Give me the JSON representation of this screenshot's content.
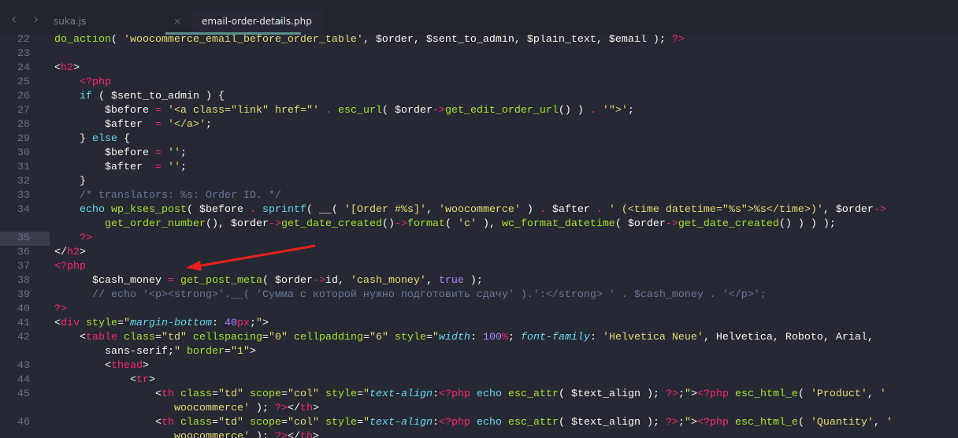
{
  "tabs": [
    {
      "label": "suka.js",
      "active": false
    },
    {
      "label": "email-order-details.php",
      "active": true
    }
  ],
  "close_glyph": "×",
  "nav": {
    "back": "‹",
    "forward": "›"
  },
  "current_line": "35",
  "rows": [
    {
      "num": "22",
      "tokens": [
        [
          "f",
          "do_action"
        ],
        [
          "v",
          "( "
        ],
        [
          "s",
          "'woocommerce_email_before_order_table'"
        ],
        [
          "v",
          ", $order, $sent_to_admin, $plain_text, $email ); "
        ],
        [
          "t",
          "?>"
        ]
      ]
    },
    {
      "num": "23",
      "tokens": []
    },
    {
      "num": "24",
      "tokens": [
        [
          "v",
          "<"
        ],
        [
          "t",
          "h2"
        ],
        [
          "v",
          ">"
        ]
      ]
    },
    {
      "num": "25",
      "tokens": [
        [
          "v",
          "    "
        ],
        [
          "t",
          "<?php"
        ]
      ]
    },
    {
      "num": "26",
      "tokens": [
        [
          "v",
          "    "
        ],
        [
          "k",
          "if"
        ],
        [
          "v",
          " ( $sent_to_admin ) {"
        ]
      ]
    },
    {
      "num": "27",
      "tokens": [
        [
          "v",
          "        $before "
        ],
        [
          "t",
          "="
        ],
        [
          "v",
          " "
        ],
        [
          "s",
          "'<a class=\"link\" href=\"'"
        ],
        [
          "v",
          " "
        ],
        [
          "t",
          "."
        ],
        [
          "v",
          " "
        ],
        [
          "f",
          "esc_url"
        ],
        [
          "v",
          "( $order"
        ],
        [
          "t",
          "->"
        ],
        [
          "f",
          "get_edit_order_url"
        ],
        [
          "v",
          "() ) "
        ],
        [
          "t",
          "."
        ],
        [
          "v",
          " "
        ],
        [
          "s",
          "'\">'"
        ],
        [
          "v",
          ";"
        ]
      ]
    },
    {
      "num": "28",
      "tokens": [
        [
          "v",
          "        $after  "
        ],
        [
          "t",
          "="
        ],
        [
          "v",
          " "
        ],
        [
          "s",
          "'</a>'"
        ],
        [
          "v",
          ";"
        ]
      ]
    },
    {
      "num": "29",
      "tokens": [
        [
          "v",
          "    } "
        ],
        [
          "k",
          "else"
        ],
        [
          "v",
          " {"
        ]
      ]
    },
    {
      "num": "30",
      "tokens": [
        [
          "v",
          "        $before "
        ],
        [
          "t",
          "="
        ],
        [
          "v",
          " "
        ],
        [
          "s",
          "''"
        ],
        [
          "v",
          ";"
        ]
      ]
    },
    {
      "num": "31",
      "tokens": [
        [
          "v",
          "        $after  "
        ],
        [
          "t",
          "="
        ],
        [
          "v",
          " "
        ],
        [
          "s",
          "''"
        ],
        [
          "v",
          ";"
        ]
      ]
    },
    {
      "num": "32",
      "tokens": [
        [
          "v",
          "    }"
        ]
      ]
    },
    {
      "num": "33",
      "tokens": [
        [
          "c",
          "    /* translators: %s: Order ID. */"
        ]
      ]
    },
    {
      "num": "34",
      "tokens": [
        [
          "v",
          "    "
        ],
        [
          "k",
          "echo"
        ],
        [
          "v",
          " "
        ],
        [
          "f",
          "wp_kses_post"
        ],
        [
          "v",
          "( $before "
        ],
        [
          "t",
          "."
        ],
        [
          "v",
          " "
        ],
        [
          "k",
          "sprintf"
        ],
        [
          "v",
          "( __( "
        ],
        [
          "s",
          "'[Order #%s]'"
        ],
        [
          "v",
          ", "
        ],
        [
          "s",
          "'woocommerce'"
        ],
        [
          "v",
          " ) "
        ],
        [
          "t",
          "."
        ],
        [
          "v",
          " $after "
        ],
        [
          "t",
          "."
        ],
        [
          "v",
          " "
        ],
        [
          "s",
          "' (<time datetime=\"%s\">%s</time>)'"
        ],
        [
          "v",
          ", $order"
        ],
        [
          "t",
          "->"
        ]
      ]
    },
    {
      "num": "",
      "tokens": [
        [
          "v",
          "        "
        ],
        [
          "f",
          "get_order_number"
        ],
        [
          "v",
          "(), $order"
        ],
        [
          "t",
          "->"
        ],
        [
          "f",
          "get_date_created"
        ],
        [
          "v",
          "()"
        ],
        [
          "t",
          "->"
        ],
        [
          "f",
          "format"
        ],
        [
          "v",
          "( "
        ],
        [
          "s",
          "'c'"
        ],
        [
          "v",
          " ), "
        ],
        [
          "f",
          "wc_format_datetime"
        ],
        [
          "v",
          "( $order"
        ],
        [
          "t",
          "->"
        ],
        [
          "f",
          "get_date_created"
        ],
        [
          "v",
          "() ) ) );"
        ]
      ]
    },
    {
      "num": "35",
      "tokens": [
        [
          "v",
          "    "
        ],
        [
          "t",
          "?>"
        ]
      ]
    },
    {
      "num": "36",
      "tokens": [
        [
          "v",
          "</"
        ],
        [
          "t",
          "h2"
        ],
        [
          "v",
          ">"
        ]
      ]
    },
    {
      "num": "37",
      "tokens": [
        [
          "t",
          "<?php"
        ]
      ]
    },
    {
      "num": "38",
      "tokens": [
        [
          "v",
          "      $cash_money "
        ],
        [
          "t",
          "="
        ],
        [
          "v",
          " "
        ],
        [
          "f",
          "get_post_meta"
        ],
        [
          "v",
          "( $order"
        ],
        [
          "t",
          "->"
        ],
        [
          "v",
          "id, "
        ],
        [
          "s",
          "'cash_money'"
        ],
        [
          "v",
          ", "
        ],
        [
          "n",
          "true"
        ],
        [
          "v",
          " );"
        ]
      ]
    },
    {
      "num": "39",
      "tokens": [
        [
          "c",
          "      // echo '<p><strong>'.__( 'Сумма с которой нужно подготовить сдачу' ).':</strong> ' . $cash_money . '</p>';"
        ]
      ]
    },
    {
      "num": "40",
      "tokens": [
        [
          "t",
          "?>"
        ]
      ]
    },
    {
      "num": "41",
      "tokens": [
        [
          "v",
          "<"
        ],
        [
          "t",
          "div"
        ],
        [
          "v",
          " "
        ],
        [
          "a",
          "style"
        ],
        [
          "v",
          "="
        ],
        [
          "s",
          "\""
        ],
        [
          "i",
          "margin-bottom"
        ],
        [
          "v",
          ": "
        ],
        [
          "n",
          "40"
        ],
        [
          "t",
          "px"
        ],
        [
          "v",
          ";"
        ],
        [
          "s",
          "\""
        ],
        [
          "v",
          ">"
        ]
      ]
    },
    {
      "num": "42",
      "tokens": [
        [
          "v",
          "    <"
        ],
        [
          "t",
          "table"
        ],
        [
          "v",
          " "
        ],
        [
          "a",
          "class"
        ],
        [
          "v",
          "="
        ],
        [
          "s",
          "\"td\""
        ],
        [
          "v",
          " "
        ],
        [
          "a",
          "cellspacing"
        ],
        [
          "v",
          "="
        ],
        [
          "s",
          "\"0\""
        ],
        [
          "v",
          " "
        ],
        [
          "a",
          "cellpadding"
        ],
        [
          "v",
          "="
        ],
        [
          "s",
          "\"6\""
        ],
        [
          "v",
          " "
        ],
        [
          "a",
          "style"
        ],
        [
          "v",
          "="
        ],
        [
          "s",
          "\""
        ],
        [
          "i",
          "width"
        ],
        [
          "v",
          ": "
        ],
        [
          "n",
          "100"
        ],
        [
          "t",
          "%"
        ],
        [
          "v",
          "; "
        ],
        [
          "i",
          "font-family"
        ],
        [
          "v",
          ": "
        ],
        [
          "s",
          "'Helvetica Neue'"
        ],
        [
          "v",
          ", Helvetica, Roboto, Arial,"
        ]
      ]
    },
    {
      "num": "",
      "tokens": [
        [
          "v",
          "        sans-serif;"
        ],
        [
          "s",
          "\""
        ],
        [
          "v",
          " "
        ],
        [
          "a",
          "border"
        ],
        [
          "v",
          "="
        ],
        [
          "s",
          "\"1\""
        ],
        [
          "v",
          ">"
        ]
      ]
    },
    {
      "num": "43",
      "tokens": [
        [
          "v",
          "        <"
        ],
        [
          "t",
          "thead"
        ],
        [
          "v",
          ">"
        ]
      ]
    },
    {
      "num": "44",
      "tokens": [
        [
          "v",
          "            <"
        ],
        [
          "t",
          "tr"
        ],
        [
          "v",
          ">"
        ]
      ]
    },
    {
      "num": "45",
      "tokens": [
        [
          "v",
          "                <"
        ],
        [
          "t",
          "th"
        ],
        [
          "v",
          " "
        ],
        [
          "a",
          "class"
        ],
        [
          "v",
          "="
        ],
        [
          "s",
          "\"td\""
        ],
        [
          "v",
          " "
        ],
        [
          "a",
          "scope"
        ],
        [
          "v",
          "="
        ],
        [
          "s",
          "\"col\""
        ],
        [
          "v",
          " "
        ],
        [
          "a",
          "style"
        ],
        [
          "v",
          "="
        ],
        [
          "s",
          "\""
        ],
        [
          "i",
          "text-align"
        ],
        [
          "v",
          ":"
        ],
        [
          "t",
          "<?php"
        ],
        [
          "v",
          " "
        ],
        [
          "k",
          "echo"
        ],
        [
          "v",
          " "
        ],
        [
          "f",
          "esc_attr"
        ],
        [
          "v",
          "( $text_align ); "
        ],
        [
          "t",
          "?>"
        ],
        [
          "v",
          ";"
        ],
        [
          "s",
          "\""
        ],
        [
          "v",
          ">"
        ],
        [
          "t",
          "<?php"
        ],
        [
          "v",
          " "
        ],
        [
          "f",
          "esc_html_e"
        ],
        [
          "v",
          "( "
        ],
        [
          "s",
          "'Product'"
        ],
        [
          "v",
          ", "
        ],
        [
          "s",
          "'"
        ]
      ]
    },
    {
      "num": "",
      "tokens": [
        [
          "v",
          "                   "
        ],
        [
          "s",
          "woocommerce'"
        ],
        [
          "v",
          " ); "
        ],
        [
          "t",
          "?>"
        ],
        [
          "v",
          "</"
        ],
        [
          "t",
          "th"
        ],
        [
          "v",
          ">"
        ]
      ]
    },
    {
      "num": "46",
      "tokens": [
        [
          "v",
          "                <"
        ],
        [
          "t",
          "th"
        ],
        [
          "v",
          " "
        ],
        [
          "a",
          "class"
        ],
        [
          "v",
          "="
        ],
        [
          "s",
          "\"td\""
        ],
        [
          "v",
          " "
        ],
        [
          "a",
          "scope"
        ],
        [
          "v",
          "="
        ],
        [
          "s",
          "\"col\""
        ],
        [
          "v",
          " "
        ],
        [
          "a",
          "style"
        ],
        [
          "v",
          "="
        ],
        [
          "s",
          "\""
        ],
        [
          "i",
          "text-align"
        ],
        [
          "v",
          ":"
        ],
        [
          "t",
          "<?php"
        ],
        [
          "v",
          " "
        ],
        [
          "k",
          "echo"
        ],
        [
          "v",
          " "
        ],
        [
          "f",
          "esc_attr"
        ],
        [
          "v",
          "( $text_align ); "
        ],
        [
          "t",
          "?>"
        ],
        [
          "v",
          ";"
        ],
        [
          "s",
          "\""
        ],
        [
          "v",
          ">"
        ],
        [
          "t",
          "<?php"
        ],
        [
          "v",
          " "
        ],
        [
          "f",
          "esc_html_e"
        ],
        [
          "v",
          "( "
        ],
        [
          "s",
          "'Quantity'"
        ],
        [
          "v",
          ", "
        ],
        [
          "s",
          "'"
        ]
      ]
    },
    {
      "num": "",
      "tokens": [
        [
          "v",
          "                   "
        ],
        [
          "s",
          "woocommerce'"
        ],
        [
          "v",
          " ); "
        ],
        [
          "t",
          "?>"
        ],
        [
          "v",
          "</"
        ],
        [
          "t",
          "th"
        ],
        [
          "v",
          ">"
        ]
      ]
    }
  ],
  "colors": {
    "arrow": "#e8201c",
    "background": "#262933"
  }
}
